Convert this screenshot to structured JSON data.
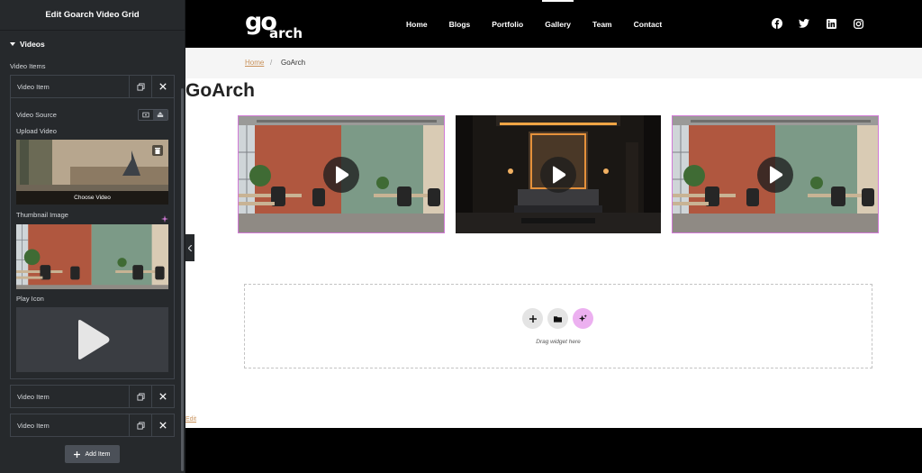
{
  "panel": {
    "title": "Edit Goarch Video Grid",
    "section": "Videos",
    "items_label": "Video Items",
    "items": [
      {
        "label": "Video Item"
      },
      {
        "label": "Video Item"
      },
      {
        "label": "Video Item"
      }
    ],
    "video_source_label": "Video Source",
    "upload_video_label": "Upload Video",
    "choose_video_label": "Choose Video",
    "thumbnail_label": "Thumbnail Image",
    "play_icon_label": "Play Icon",
    "add_item_label": "Add Item",
    "icons": {
      "copy": "copy-icon",
      "close": "close-icon",
      "source_external": "external-link-icon",
      "source_upload": "upload-icon",
      "trash": "trash-icon",
      "ai": "ai-sparkle-icon",
      "play": "play-icon",
      "collapse": "chevron-left-icon",
      "add": "plus-icon"
    }
  },
  "site": {
    "logo_text": "go arch",
    "nav": [
      {
        "label": "Home"
      },
      {
        "label": "Blogs"
      },
      {
        "label": "Portfolio"
      },
      {
        "label": "Gallery",
        "active": true
      },
      {
        "label": "Team"
      },
      {
        "label": "Contact"
      }
    ],
    "social_icons": [
      "facebook-icon",
      "twitter-icon",
      "linkedin-icon",
      "instagram-icon"
    ],
    "breadcrumb": {
      "home": "Home",
      "separator": "/",
      "current": "GoArch"
    },
    "page_title": "GoArch",
    "videos": [
      {
        "scene": "office",
        "selected": true
      },
      {
        "scene": "bedroom",
        "selected": false
      },
      {
        "scene": "office",
        "selected": true
      }
    ],
    "drop_zone_text": "Drag widget here",
    "edit_link": "Edit"
  },
  "colors": {
    "panel_bg": "#26292c",
    "selection": "#d17ad6",
    "ai_button": "#ecb0f0",
    "link": "#c9925b"
  }
}
